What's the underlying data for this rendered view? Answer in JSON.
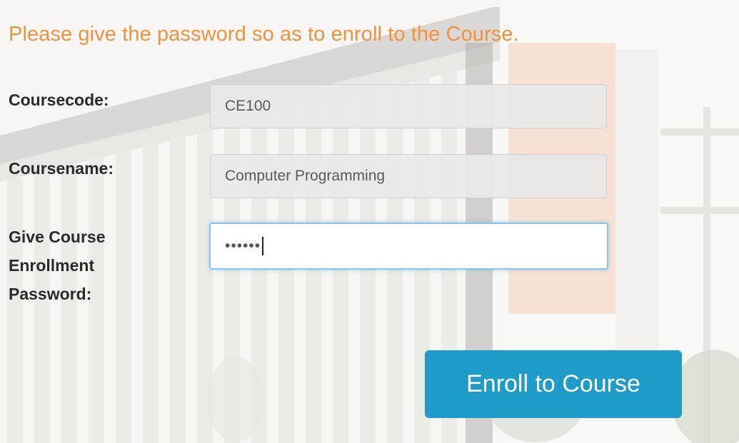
{
  "heading": "Please give the password so as to enroll to the Course.",
  "form": {
    "coursecode": {
      "label": "Coursecode:",
      "value": "CE100"
    },
    "coursename": {
      "label": "Coursename:",
      "value": "Computer Programming"
    },
    "password": {
      "label_line1": "Give Course",
      "label_line2": "Enrollment",
      "label_line3": "Password:",
      "masked_value": "••••••"
    }
  },
  "submit_label": "Enroll to Course",
  "colors": {
    "heading": "#f0933c",
    "button": "#1e9bc9",
    "focus_border": "#8ec2e6"
  }
}
